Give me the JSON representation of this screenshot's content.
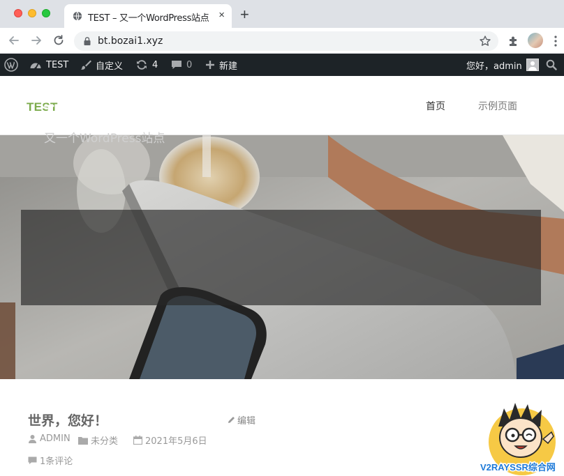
{
  "browser": {
    "tab_title": "TEST – 又一个WordPress站点",
    "tab_close": "×",
    "new_tab": "+",
    "url": "bt.bozai1.xyz"
  },
  "admin_bar": {
    "site_name": "TEST",
    "customize": "自定义",
    "updates_count": "4",
    "comments_count": "0",
    "new": "新建",
    "greeting": "您好，admin"
  },
  "site": {
    "title": "TEST",
    "menu": [
      "首页",
      "示例页面"
    ],
    "accent_color": "#7cab4c"
  },
  "hero": {
    "title": "TEST",
    "subtitle": "又一个WordPress站点"
  },
  "post": {
    "title": "世界，您好！",
    "edit": "编辑",
    "author": "ADMIN",
    "category": "未分类",
    "date": "2021年5月6日",
    "comments": "1条评论"
  },
  "watermark": {
    "text": "V2RAYSSR综合网"
  }
}
